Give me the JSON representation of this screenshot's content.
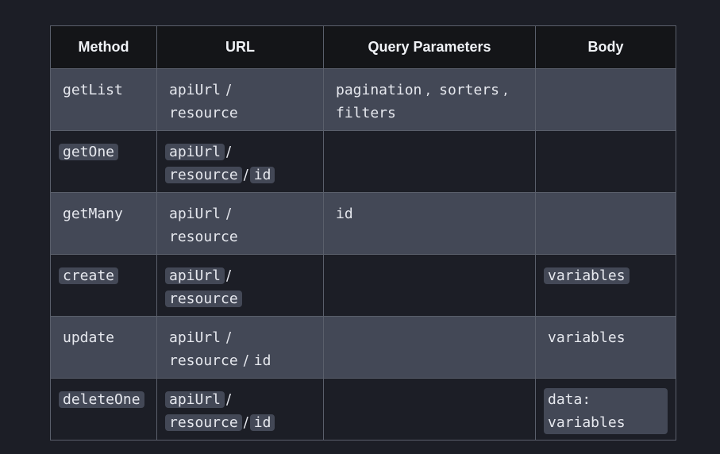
{
  "table": {
    "headers": {
      "method": "Method",
      "url": "URL",
      "query": "Query Parameters",
      "body": "Body"
    },
    "rows": [
      {
        "method": "getList",
        "url": [
          "apiUrl",
          "/",
          "resource"
        ],
        "query": [
          "pagination",
          ",",
          "sorters",
          ",",
          "filters"
        ],
        "body": ""
      },
      {
        "method": "getOne",
        "url": [
          "apiUrl",
          "/",
          "resource",
          "/",
          "id"
        ],
        "query": "",
        "body": ""
      },
      {
        "method": "getMany",
        "url": [
          "apiUrl",
          "/",
          "resource"
        ],
        "query": "id",
        "body": ""
      },
      {
        "method": "create",
        "url": [
          "apiUrl",
          "/",
          "resource"
        ],
        "query": "",
        "body": "variables"
      },
      {
        "method": "update",
        "url": [
          "apiUrl",
          "/",
          "resource",
          "/",
          "id"
        ],
        "query": "",
        "body": "variables"
      },
      {
        "method": "deleteOne",
        "url": [
          "apiUrl",
          "/",
          "resource",
          "/",
          "id"
        ],
        "query": "",
        "body": [
          "data:",
          "variables"
        ]
      }
    ]
  },
  "colors": {
    "page_background": "#1c1e26",
    "header_background": "#141518",
    "shaded_row": "#434856",
    "code_chip": "#434856",
    "border": "#5a5f6b",
    "text": "#e6e8ee"
  }
}
